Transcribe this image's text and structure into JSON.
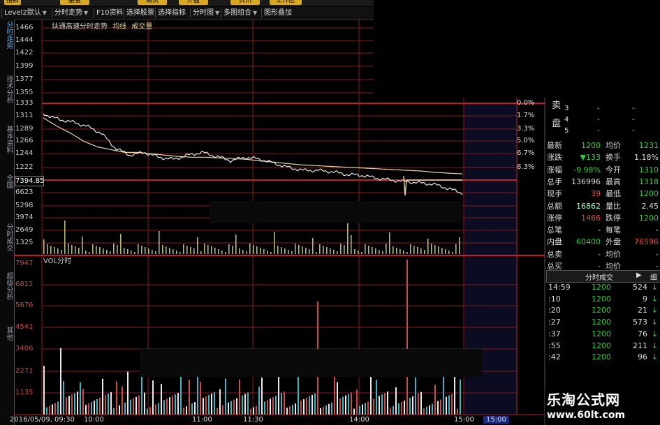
{
  "toolbar": {
    "top_buttons": [
      "指数",
      "基金",
      "期货",
      "外盘",
      "资讯",
      "工作区"
    ],
    "items": [
      {
        "label": "Level2默认",
        "dropdown": true
      },
      {
        "label": "分时走势",
        "dropdown": true
      },
      {
        "label": "F10资料",
        "dropdown": false
      },
      {
        "label": "选择股票",
        "dropdown": false
      },
      {
        "label": "选择指标",
        "dropdown": false
      },
      {
        "label": "分时图",
        "dropdown": true
      },
      {
        "label": "多图组合",
        "dropdown": true
      },
      {
        "label": "图形叠加",
        "dropdown": false
      }
    ]
  },
  "left_tabs": [
    {
      "label": "分时走势",
      "active": true
    },
    {
      "label": "技术分析",
      "active": false
    },
    {
      "label": "基本资料",
      "active": false
    },
    {
      "label": "全国",
      "active": false
    },
    {
      "label": "分时成交",
      "active": false
    },
    {
      "label": "超级分析",
      "active": false
    },
    {
      "label": "其他",
      "active": false
    }
  ],
  "legend": {
    "title": "扶通高速分时走势",
    "avg": "均线",
    "vol": "成交量"
  },
  "price_axis": [
    "1466",
    "1444",
    "1422",
    "1399",
    "1377",
    "1355",
    "1333",
    "1311",
    "1289",
    "1266",
    "1244",
    "1222"
  ],
  "pct_axis": [
    "0.0%",
    "1.7%",
    "3.3%",
    "5.0%",
    "6.7%",
    "8.3%"
  ],
  "current_price_label": "7394.85",
  "mid_axis": [
    "6623",
    "5298",
    "3974",
    "2649",
    "1325"
  ],
  "vol_header": "VOL分时",
  "vol_axis": [
    "7947",
    "6812",
    "5676",
    "4541",
    "3406",
    "2271",
    "1135"
  ],
  "time_axis": [
    "2016/05/09, 09:30",
    "10:00",
    "11:00",
    "11:30",
    "14:00",
    "15:00"
  ],
  "time_highlight": "15:00",
  "orderbook": [
    {
      "label": "3",
      "a": "-",
      "b": "-"
    },
    {
      "label": "4",
      "a": "-",
      "b": "-"
    },
    {
      "label": "5",
      "a": "-",
      "b": "-"
    }
  ],
  "orderbook_side": [
    "卖",
    "盘"
  ],
  "quote_rows": [
    {
      "l1": "最新",
      "v1": "1200",
      "l2": "均价",
      "v2": "1231",
      "c1": "#2ecc40",
      "c2": "#2ecc40"
    },
    {
      "l1": "涨跌",
      "v1": "▼133",
      "l2": "换手",
      "v2": "1.18%",
      "c1": "#2ecc40",
      "c2": "#ddd"
    },
    {
      "l1": "涨幅",
      "v1": "-9.98%",
      "l2": "今开",
      "v2": "1310",
      "c1": "#2ecc40",
      "c2": "#2ecc40"
    },
    {
      "l1": "总手",
      "v1": "136996",
      "l2": "最高",
      "v2": "1318",
      "c1": "#ddd",
      "c2": "#2ecc40"
    },
    {
      "l1": "现手",
      "v1": "39",
      "l2": "最低",
      "v2": "1200",
      "c1": "#e74c3c",
      "c2": "#2ecc40"
    },
    {
      "l1": "总额",
      "v1": "16862",
      "l2": "量比",
      "v2": "2.45",
      "c1": "#9fd",
      "c2": "#ddd"
    },
    {
      "l1": "涨停",
      "v1": "1466",
      "l2": "跌停",
      "v2": "1200",
      "c1": "#e74c3c",
      "c2": "#2ecc40"
    },
    {
      "l1": "总笔",
      "v1": "-",
      "l2": "每笔",
      "v2": "-",
      "c1": "#ddd",
      "c2": "#ddd"
    },
    {
      "l1": "内盘",
      "v1": "60400",
      "l2": "外盘",
      "v2": "76596",
      "c1": "#2ecc40",
      "c2": "#e74c3c"
    },
    {
      "l1": "总卖",
      "v1": "-",
      "l2": "均价",
      "v2": "-",
      "c1": "#ddd",
      "c2": "#ddd"
    },
    {
      "l1": "总买",
      "v1": "-",
      "l2": "均价",
      "v2": "-",
      "c1": "#ddd",
      "c2": "#ddd"
    }
  ],
  "trades_header": {
    "title": "分时成交",
    "btn": "▶",
    "btn2": "细"
  },
  "trades": [
    {
      "t": "14:59",
      "p": "1200",
      "v": "524",
      "a": "↓"
    },
    {
      "t": ":10",
      "p": "1200",
      "v": "9",
      "a": "↓"
    },
    {
      "t": ":20",
      "p": "1200",
      "v": "21",
      "a": "↓"
    },
    {
      "t": ":27",
      "p": "1200",
      "v": "573",
      "a": "↓"
    },
    {
      "t": ":37",
      "p": "1200",
      "v": "76",
      "a": "↓"
    },
    {
      "t": ":55",
      "p": "1200",
      "v": "211",
      "a": "↓"
    },
    {
      "t": ":42",
      "p": "1200",
      "v": "96",
      "a": "↓"
    }
  ],
  "watermark": {
    "line1": "乐淘公式网",
    "line2": "www.60lt.com"
  },
  "colors": {
    "grid": "#8b1a1a",
    "grid_bright": "#c0202a",
    "price_line": "#e8e8e8",
    "avg_line": "#e8d89a",
    "vol_up": "#3ab8c8",
    "vol_down": "#e8e8e8",
    "vol_top": "#b8b87a",
    "plot_dark": "#0b0b22"
  },
  "chart_data": {
    "type": "line",
    "title": "扶通高速分时走势",
    "price": [
      1318,
      1310,
      1306,
      1300,
      1290,
      1268,
      1258,
      1262,
      1255,
      1252,
      1258,
      1262,
      1256,
      1250,
      1255,
      1252,
      1246,
      1240,
      1236,
      1236,
      1234,
      1230,
      1229,
      1225,
      1222,
      1220,
      1218,
      1216,
      1210,
      1203,
      1200,
      1200
    ],
    "avg": [
      1312,
      1300,
      1290,
      1278,
      1270,
      1266,
      1262,
      1262,
      1260,
      1258,
      1256,
      1255,
      1255,
      1254,
      1253,
      1252,
      1250,
      1248,
      1246,
      1244,
      1243,
      1242,
      1241,
      1240,
      1239,
      1238,
      1237,
      1236,
      1235,
      1233,
      1232,
      1231
    ],
    "ylim": [
      1222,
      1333
    ],
    "volume": [
      420,
      2600,
      1800,
      3400,
      1200,
      900,
      2100,
      1500,
      800,
      1300,
      2271,
      700,
      600,
      900,
      500,
      800,
      1100,
      700,
      6500,
      600,
      1200,
      800,
      900,
      700,
      600,
      1500,
      1200,
      900,
      7947,
      700,
      600,
      2100
    ]
  }
}
